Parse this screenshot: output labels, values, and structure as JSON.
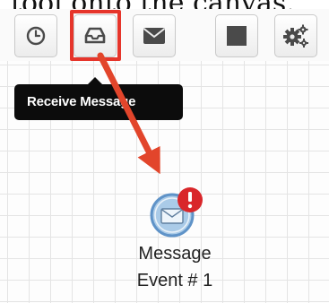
{
  "caption": {
    "text": "tool onto the canvas."
  },
  "toolbar": {
    "buttons": [
      {
        "name": "timer",
        "icon": "clock-icon"
      },
      {
        "name": "receive-message",
        "icon": "inbox-icon",
        "highlighted": true
      },
      {
        "name": "send-message",
        "icon": "envelope-icon"
      },
      {
        "name": "action",
        "icon": "square-icon"
      },
      {
        "name": "settings",
        "icon": "gears-icon"
      }
    ]
  },
  "tooltip": {
    "text": "Receive Message"
  },
  "event_node": {
    "label_line1": "Message",
    "label_line2": "Event # 1",
    "icon": "envelope-icon",
    "badge_icon": "exclamation-icon"
  },
  "colors": {
    "highlight": "#e6352b",
    "arrow": "#e2452b",
    "node_fill": "#aacbe8",
    "node_border": "#5f93c8",
    "badge": "#d9262a",
    "tooltip_bg": "#0c0c0c"
  }
}
